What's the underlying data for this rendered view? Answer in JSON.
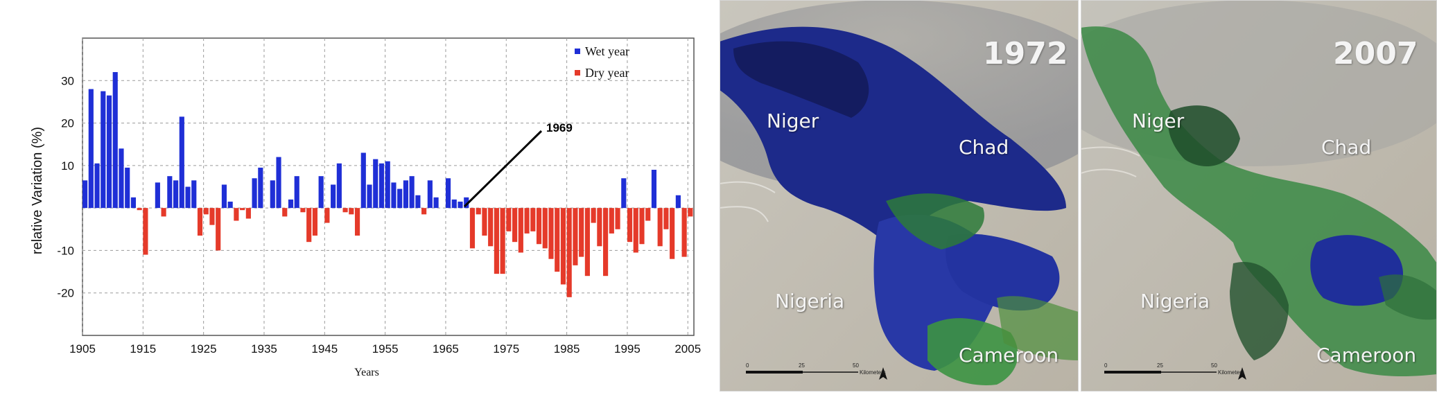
{
  "chart_data": {
    "type": "bar",
    "xlabel": "Years",
    "ylabel": "relative Variation (%)",
    "xlim": [
      1905,
      2006
    ],
    "ylim": [
      -30,
      40
    ],
    "xticks": [
      1905,
      1915,
      1925,
      1935,
      1945,
      1955,
      1965,
      1975,
      1985,
      1995,
      2005
    ],
    "yticks": [
      30,
      20,
      10,
      -10,
      -20
    ],
    "grid": true,
    "legend_position": "top-right",
    "legend": [
      {
        "label": "Wet year",
        "color": "#1f2fd6"
      },
      {
        "label": "Dry year",
        "color": "#e53a2a"
      }
    ],
    "annotation": {
      "text": "1969",
      "year": 1969
    },
    "series": [
      {
        "name": "Wet year",
        "color": "#1f2fd6",
        "x": [
          1905,
          1906,
          1907,
          1908,
          1909,
          1910,
          1911,
          1912,
          1913,
          1917,
          1919,
          1920,
          1921,
          1922,
          1923,
          1928,
          1929,
          1933,
          1934,
          1936,
          1937,
          1939,
          1940,
          1944,
          1946,
          1947,
          1951,
          1952,
          1953,
          1954,
          1955,
          1956,
          1957,
          1958,
          1959,
          1960,
          1962,
          1963,
          1965,
          1966,
          1967,
          1968,
          1994,
          1999,
          2003
        ],
        "y": [
          6.5,
          28,
          10.5,
          27.5,
          26.5,
          32,
          14,
          9.5,
          2.5,
          6,
          7.5,
          6.5,
          21.5,
          5,
          6.5,
          5.5,
          1.5,
          7,
          9.5,
          6.5,
          12,
          2,
          7.5,
          7.5,
          5.5,
          10.5,
          13,
          5.5,
          11.5,
          10.5,
          11,
          6,
          4.5,
          6.5,
          7.5,
          3,
          6.5,
          2.5,
          7,
          2,
          1.5,
          2.5,
          7,
          9,
          3
        ]
      },
      {
        "name": "Dry year",
        "color": "#e53a2a",
        "x": [
          1914,
          1915,
          1918,
          1924,
          1925,
          1926,
          1927,
          1930,
          1931,
          1932,
          1938,
          1941,
          1942,
          1943,
          1945,
          1948,
          1949,
          1950,
          1961,
          1969,
          1970,
          1971,
          1972,
          1973,
          1974,
          1975,
          1976,
          1977,
          1978,
          1979,
          1980,
          1981,
          1982,
          1983,
          1984,
          1985,
          1986,
          1987,
          1988,
          1989,
          1990,
          1991,
          1992,
          1993,
          1995,
          1996,
          1997,
          1998,
          2000,
          2001,
          2002,
          2004,
          2005
        ],
        "y": [
          -0.5,
          -11,
          -2,
          -6.5,
          -1.5,
          -4,
          -10,
          -3,
          -0.5,
          -2.5,
          -2,
          -1,
          -8,
          -6.5,
          -3.5,
          -1,
          -1.5,
          -6.5,
          -1.5,
          -9.5,
          -1.5,
          -6.5,
          -9,
          -15.5,
          -15.5,
          -5.5,
          -8,
          -10.5,
          -6,
          -5.5,
          -8.5,
          -9.5,
          -12,
          -15,
          -18,
          -21,
          -13.5,
          -11.5,
          -16,
          -3.5,
          -9,
          -16,
          -6,
          -5,
          -8,
          -10.5,
          -8.5,
          -3,
          -9,
          -5,
          -12,
          -11.5,
          -2
        ]
      }
    ]
  },
  "maps": {
    "year_left": "1972",
    "year_right": "2007",
    "labels": {
      "niger": "Niger",
      "chad": "Chad",
      "nigeria": "Nigeria",
      "cameroon": "Cameroon"
    },
    "scale": {
      "zero": "0",
      "mid": "25",
      "max": "50",
      "unit": "Kilometers"
    }
  }
}
